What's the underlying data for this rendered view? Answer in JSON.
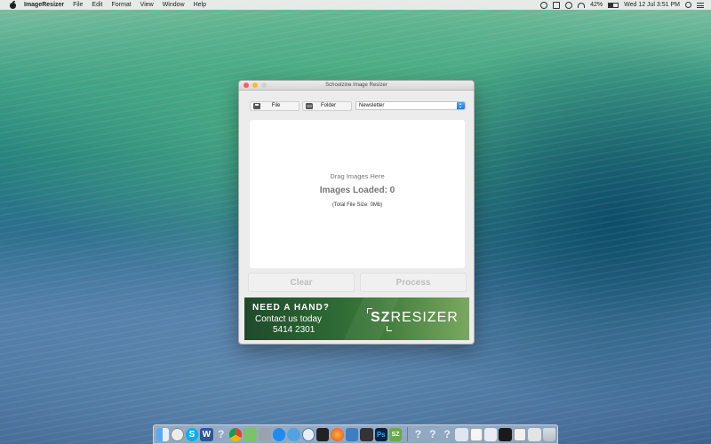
{
  "menubar": {
    "app_name": "ImageResizer",
    "items": [
      "File",
      "Edit",
      "Format",
      "View",
      "Window",
      "Help"
    ],
    "battery_percent": "42%",
    "datetime": "Wed 12 Jul  3:51 PM"
  },
  "window": {
    "title": "Schoolzine Image Resizer",
    "toolbar": {
      "file_label": "File",
      "folder_label": "Folder",
      "preset_selected": "Newsletter"
    },
    "dropzone": {
      "instruction": "Drag Images Here",
      "images_loaded": "Images Loaded: 0",
      "total_size": "(Total File Size: 0Mb)"
    },
    "buttons": {
      "clear_label": "Clear",
      "process_label": "Process"
    },
    "banner": {
      "headline": "NEED A HAND?",
      "contact": "Contact us today",
      "phone": "5414 2301",
      "logo_sz": "SZ",
      "logo_rest": "RESIZER"
    }
  },
  "dock": {
    "icons": [
      "finder-icon",
      "clock-icon",
      "skype-icon",
      "word-icon",
      "question-icon",
      "chrome-icon",
      "maps-icon",
      "automator-icon",
      "appstore-icon",
      "chat-icon",
      "safari-icon",
      "terminal-icon",
      "firefox-icon",
      "xcode-icon",
      "terminal2-icon",
      "photoshop-icon",
      "sz-icon",
      "question2-icon",
      "question3-icon",
      "question4-icon",
      "window1-icon",
      "window2-icon",
      "window3-icon",
      "window4-icon",
      "window5-icon",
      "window6-icon",
      "trash-icon"
    ],
    "photoshop_label": "Ps",
    "skype_label": "S",
    "word_label": "W",
    "sz_label": "SZ",
    "question_label": "?"
  }
}
